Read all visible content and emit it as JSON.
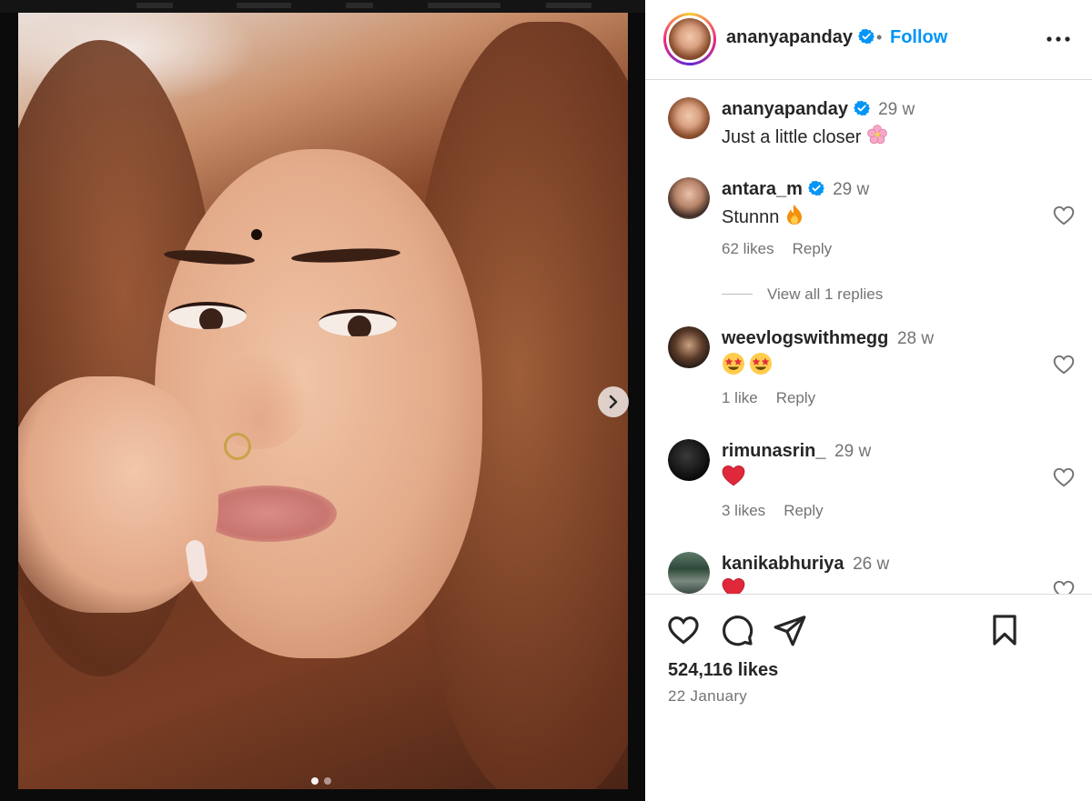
{
  "post": {
    "slide_count": 2,
    "active_slide": 1
  },
  "header": {
    "username": "ananyapanday",
    "separator": "•",
    "follow_label": "Follow"
  },
  "caption": {
    "username": "ananyapanday",
    "time": "29 w",
    "text": "Just a little closer"
  },
  "comments": [
    {
      "username": "antara_m",
      "verified": true,
      "time": "29 w",
      "text": "Stunnn",
      "likes": "62 likes",
      "reply_label": "Reply",
      "view_replies": "View all 1 replies"
    },
    {
      "username": "weevlogswithmegg",
      "verified": false,
      "time": "28 w",
      "text": "",
      "likes": "1 like",
      "reply_label": "Reply"
    },
    {
      "username": "rimunasrin_",
      "verified": false,
      "time": "29 w",
      "text": "",
      "likes": "3 likes",
      "reply_label": "Reply"
    },
    {
      "username": "kanikabhuriya",
      "verified": false,
      "time": "26 w",
      "text": ""
    }
  ],
  "actions": {
    "likes": "524,116 likes",
    "date": "22 January"
  },
  "colors": {
    "link_blue": "#0095f6",
    "verified_blue": "#0095f6",
    "text": "#262626",
    "secondary": "#737373"
  }
}
